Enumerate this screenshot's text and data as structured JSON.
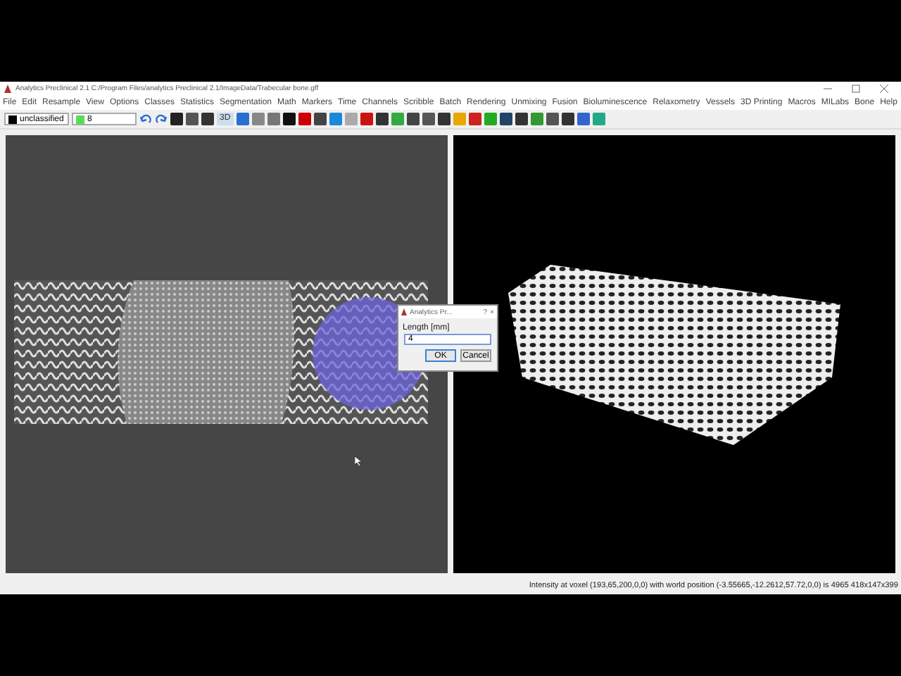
{
  "window": {
    "title": "Analytics Preclinical 2.1 C:/Program Files/analytics Preclinical 2.1/ImageData/Trabecular bone.gff"
  },
  "menu": [
    "File",
    "Edit",
    "Resample",
    "View",
    "Options",
    "Classes",
    "Statistics",
    "Segmentation",
    "Math",
    "Markers",
    "Time",
    "Channels",
    "Scribble",
    "Batch",
    "Rendering",
    "Unmixing",
    "Fusion",
    "Bioluminescence",
    "Relaxometry",
    "Vessels",
    "3D Printing",
    "Macros",
    "MILabs",
    "Bone",
    "Help"
  ],
  "toolbar": {
    "class_dropdown": "unclassified",
    "label_dropdown": "8",
    "view_3d": "3D"
  },
  "dialog": {
    "title": "Analytics Pr...",
    "help": "?",
    "close": "×",
    "label": "Length [mm]",
    "value": "4",
    "buttons": [
      "OK",
      "Cancel"
    ]
  },
  "status_bar": "Intensity at voxel (193,65,200,0,0) with world position (-3.55665,-12.2612,57.72,0,0) is 4965 418x147x399"
}
